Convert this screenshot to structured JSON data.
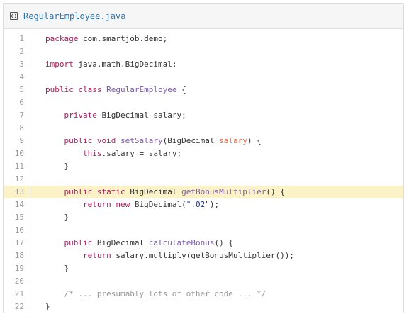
{
  "file": {
    "name": "RegularEmployee.java",
    "icon": "code-file-icon"
  },
  "colors": {
    "keyword": "#a71d5d",
    "function": "#795da3",
    "string": "#183691",
    "comment": "#969896",
    "parameter": "#ed6a43",
    "highlight": "#fbf2c8",
    "filename": "#3572a5"
  },
  "highlighted_line": 13,
  "lines": [
    {
      "n": "1",
      "tokens": [
        {
          "t": "package com.smartjob.demo;",
          "c": "pl"
        }
      ]
    },
    {
      "n": "2",
      "tokens": []
    },
    {
      "n": "3",
      "tokens": [
        {
          "t": "import java.math.BigDecimal;",
          "c": "pl"
        }
      ]
    },
    {
      "n": "4",
      "tokens": []
    },
    {
      "n": "5",
      "tokens": [
        {
          "t": "public class ",
          "c": "pl"
        },
        {
          "t": "RegularEmployee",
          "c": "fn"
        },
        {
          "t": " {",
          "c": "pl"
        }
      ]
    },
    {
      "n": "6",
      "tokens": []
    },
    {
      "n": "7",
      "tokens": [
        {
          "t": "    private BigDecimal salary;",
          "c": "pl"
        }
      ]
    },
    {
      "n": "8",
      "tokens": []
    },
    {
      "n": "9",
      "tokens": [
        {
          "t": "    public void ",
          "c": "pl"
        },
        {
          "t": "setSalary",
          "c": "fn"
        },
        {
          "t": "(BigDecimal ",
          "c": "pl"
        },
        {
          "t": "salary",
          "c": "pn"
        },
        {
          "t": ") {",
          "c": "pl"
        }
      ]
    },
    {
      "n": "10",
      "tokens": [
        {
          "t": "        ",
          "c": "pl"
        },
        {
          "t": "this",
          "c": "th"
        },
        {
          "t": ".salary = salary;",
          "c": "pl"
        }
      ]
    },
    {
      "n": "11",
      "tokens": [
        {
          "t": "    }",
          "c": "pl"
        }
      ]
    },
    {
      "n": "12",
      "tokens": []
    },
    {
      "n": "13",
      "tokens": [
        {
          "t": "    public static BigDecimal ",
          "c": "pl"
        },
        {
          "t": "getBonusMultiplier",
          "c": "fn"
        },
        {
          "t": "() {",
          "c": "pl"
        }
      ]
    },
    {
      "n": "14",
      "tokens": [
        {
          "t": "        return new BigDecimal(",
          "c": "pl"
        },
        {
          "t": "\".02\"",
          "c": "str"
        },
        {
          "t": ");",
          "c": "pl"
        }
      ]
    },
    {
      "n": "15",
      "tokens": [
        {
          "t": "    }",
          "c": "pl"
        }
      ]
    },
    {
      "n": "16",
      "tokens": []
    },
    {
      "n": "17",
      "tokens": [
        {
          "t": "    public BigDecimal ",
          "c": "pl"
        },
        {
          "t": "calculateBonus",
          "c": "fn"
        },
        {
          "t": "() {",
          "c": "pl"
        }
      ]
    },
    {
      "n": "18",
      "tokens": [
        {
          "t": "        return salary.multiply(getBonusMultiplier());",
          "c": "pl"
        }
      ]
    },
    {
      "n": "19",
      "tokens": [
        {
          "t": "    }",
          "c": "pl"
        }
      ]
    },
    {
      "n": "20",
      "tokens": []
    },
    {
      "n": "21",
      "tokens": [
        {
          "t": "    /* ... presumably lots of other code ... */",
          "c": "cm"
        }
      ]
    },
    {
      "n": "22",
      "tokens": [
        {
          "t": "}",
          "c": "pl"
        }
      ]
    }
  ]
}
